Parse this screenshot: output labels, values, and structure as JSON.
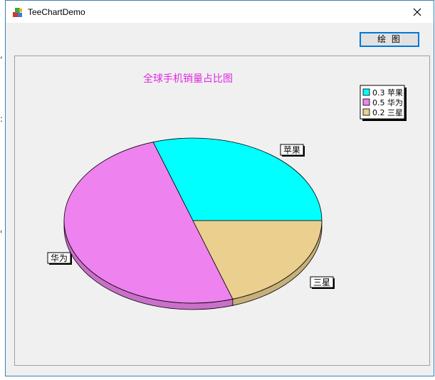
{
  "window": {
    "title": "TeeChartDemo",
    "draw_button_label": "绘 图"
  },
  "chart_data": {
    "type": "pie",
    "title": "全球手机销量占比图",
    "categories": [
      "苹果",
      "华为",
      "三星"
    ],
    "values": [
      0.3,
      0.5,
      0.2
    ],
    "colors": [
      "#00ffff",
      "#ee82ee",
      "#eacf8e"
    ],
    "legend_entries": [
      "0.3 苹果",
      "0.5 华为",
      "0.2 三星"
    ],
    "legend_placement": "top-right",
    "title_color": "#e028e0",
    "three_d": true
  },
  "icons": {
    "app": "app-icon",
    "close": "close-icon"
  }
}
